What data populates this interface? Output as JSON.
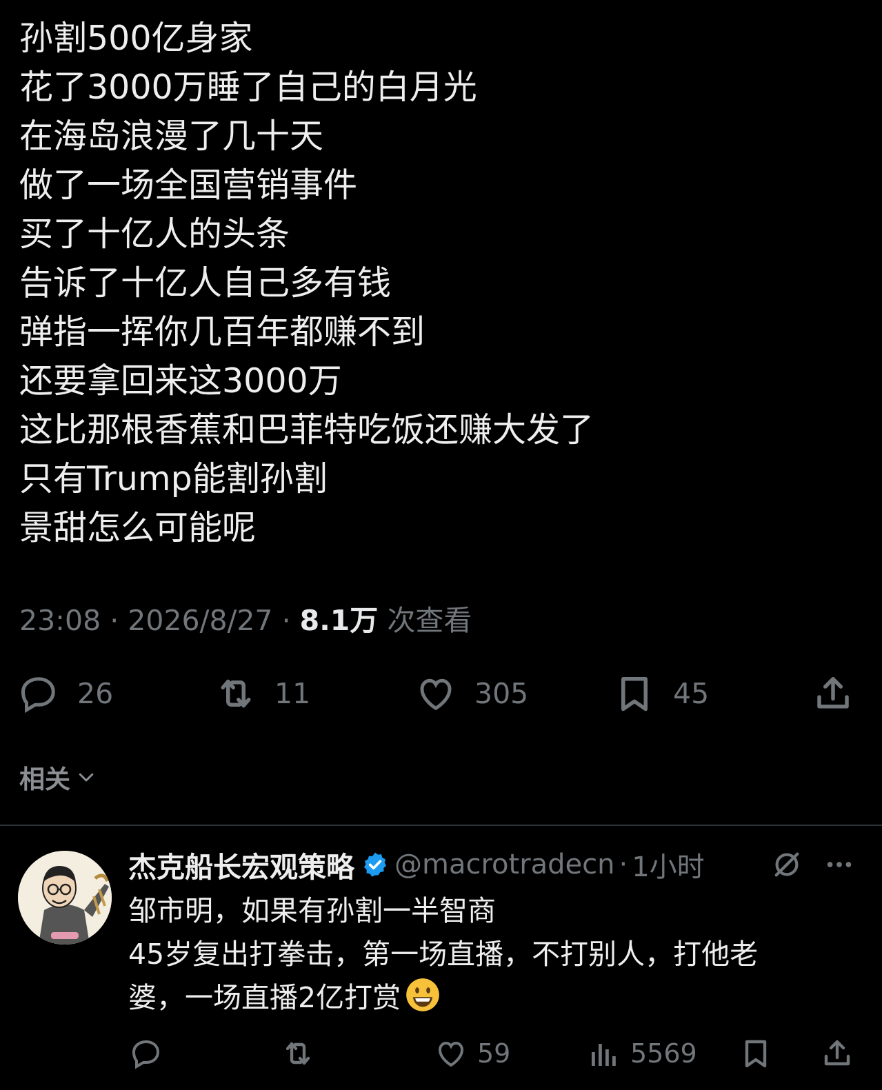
{
  "tweet": {
    "lines": [
      "孙割500亿身家",
      "花了3000万睡了自己的白月光",
      "在海岛浪漫了几十天",
      "做了一场全国营销事件",
      "买了十亿人的头条",
      "告诉了十亿人自己多有钱",
      "弹指一挥你几百年都赚不到",
      "还要拿回来这3000万",
      "这比那根香蕉和巴菲特吃饭还赚大发了",
      "只有Trump能割孙割",
      "景甜怎么可能呢"
    ],
    "time": "23:08",
    "date": "2026/8/27",
    "views": "8.1万",
    "views_label": "次查看",
    "separator": "·"
  },
  "actions": {
    "replies": "26",
    "reposts": "11",
    "likes": "305",
    "bookmarks": "45"
  },
  "related": {
    "label": "相关"
  },
  "reply": {
    "name": "杰克船长宏观策略",
    "handle": "@macrotradecn",
    "separator": "·",
    "time": "1小时",
    "lines": [
      "邹市明，如果有孙割一半智商",
      "45岁复出打拳击，第一场直播，不打别人，打他老",
      "婆，一场直播2亿打赏"
    ],
    "actions": {
      "likes": "59",
      "views": "5569"
    }
  },
  "colors": {
    "background": "#000000",
    "text": "#e7e9ea",
    "muted": "#71767b",
    "verified": "#1d9bf0",
    "divider": "#2f3336"
  },
  "icons": [
    "reply-icon",
    "repost-icon",
    "like-icon",
    "bookmark-icon",
    "share-icon",
    "chevron-down-icon",
    "verified-icon",
    "grok-icon",
    "more-icon",
    "views-icon",
    "smiley-emoji"
  ]
}
